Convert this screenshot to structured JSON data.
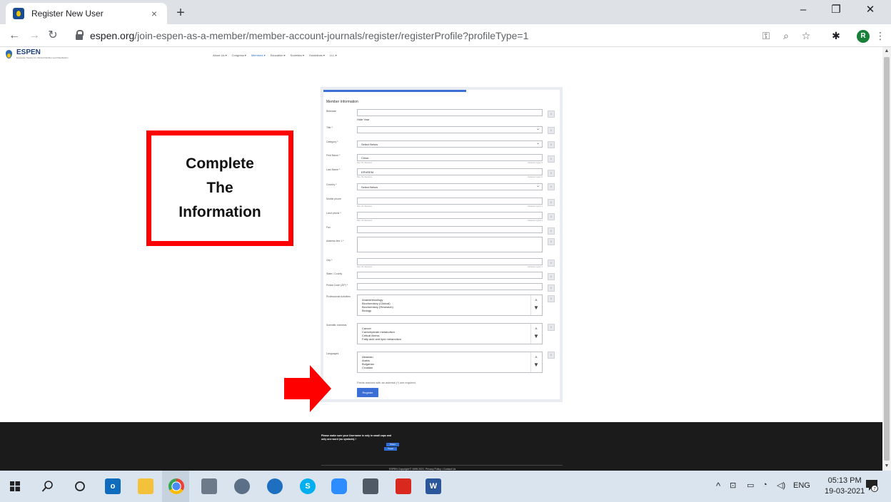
{
  "browser": {
    "tab_title": "Register New User",
    "tab_close": "×",
    "new_tab": "+",
    "url_domain": "espen.org",
    "url_path": "/join-espen-as-a-member/member-account-journals/register/registerProfile?profileType=1",
    "profile_initial": "R",
    "window": {
      "minimize": "–",
      "restore": "❐",
      "close": "✕"
    }
  },
  "site": {
    "logo_name": "ESPEN",
    "logo_tagline": "European Society for Clinical Nutrition and Metabolism",
    "nav": [
      "About Us ▾",
      "Congress ▾",
      "Members ▾",
      "Education ▾",
      "Societies ▾",
      "Guidelines ▾",
      "LLL ▾"
    ]
  },
  "annotation": {
    "lines": [
      "Complete",
      "The",
      "Information"
    ],
    "colors": {
      "box": "#ff0000",
      "arrow": "#ff0000"
    }
  },
  "form": {
    "section_title": "Member Information",
    "fields": {
      "birthdate": {
        "label": "Birthdate",
        "hint": "Hide Year"
      },
      "title": {
        "label": "Title *"
      },
      "category": {
        "label": "Category *",
        "value": "Select Below"
      },
      "first_name": {
        "label": "First Name *",
        "value": "Chloe",
        "hint_left": "Max. 50 characters",
        "hint_right": "characters typed: 5"
      },
      "last_name": {
        "label": "Last Name *",
        "value": "EPHREM",
        "hint_left": "Max. 50 characters",
        "hint_right": "characters typed: 6"
      },
      "country": {
        "label": "Country *",
        "value": "Select Below"
      },
      "mobile": {
        "label": "Mobile phone",
        "hint_left": "Max. 20 characters",
        "hint_right": "characters typed: 0"
      },
      "land_phone": {
        "label": "Land phone *",
        "hint_left": "Max. 20 characters",
        "hint_right": "characters typed: 0"
      },
      "fax": {
        "label": "Fax"
      },
      "address": {
        "label": "Address line 1 *"
      },
      "city": {
        "label": "City *",
        "hint_left": "Max. 50 characters",
        "hint_right": "characters typed: 0"
      },
      "state": {
        "label": "State / County"
      },
      "postal": {
        "label": "Postal Code (ZIP) *"
      },
      "professional": {
        "label": "Professional Activities",
        "options": [
          "Anaesthesiology",
          "Biochemistry (Clinical)",
          "Biochemistry (Research)",
          "Biology"
        ]
      },
      "scientific": {
        "label": "Scientific Interests",
        "options": [
          "Cancer",
          "Carbohydrate metabolism",
          "Critical illness",
          "Fatty acid and lipid metabolism"
        ]
      },
      "languages": {
        "label": "Languages",
        "options": [
          "Albanian",
          "Arabic",
          "Bulgarian",
          "Croatian"
        ]
      }
    },
    "info_btn": "i",
    "required_note": "Fields marked with an asterisk (*) are required.",
    "register_label": "Register"
  },
  "footer": {
    "message": "Please make sure your Username is only in small caps and only one word (no symbols) !",
    "share": "Share",
    "tweet": "Tweet",
    "copyright": "ESPEN Copyright © 1999-2021.   Privacy Policy • Contact Us"
  },
  "taskbar": {
    "tray_lang": "ENG",
    "time": "05:13 PM",
    "date": "19-03-2021",
    "notif_count": "7"
  }
}
